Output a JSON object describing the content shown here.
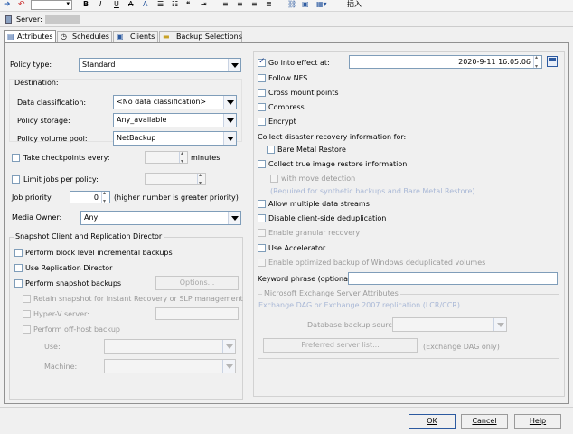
{
  "server": {
    "label": "Server:"
  },
  "tabs": [
    {
      "label": "Attributes"
    },
    {
      "label": "Schedules"
    },
    {
      "label": "Clients"
    },
    {
      "label": "Backup Selections"
    }
  ],
  "toolbar": {
    "insert_label": "插入"
  },
  "left": {
    "policy_type": {
      "label": "Policy type:",
      "value": "Standard"
    },
    "destination": {
      "title": "Destination:",
      "data_classification": {
        "label": "Data classification:",
        "value": "<No data classification>"
      },
      "policy_storage": {
        "label": "Policy storage:",
        "value": "Any_available"
      },
      "policy_volume_pool": {
        "label": "Policy volume pool:",
        "value": "NetBackup"
      }
    },
    "checkpoints": {
      "label": "Take checkpoints every:",
      "unit": "minutes"
    },
    "limit_jobs": {
      "label": "Limit jobs per policy:"
    },
    "job_priority": {
      "label": "Job priority:",
      "value": "0",
      "hint": "(higher number is greater priority)"
    },
    "media_owner": {
      "label": "Media Owner:",
      "value": "Any"
    },
    "snapshot": {
      "title": "Snapshot Client and Replication Director",
      "block_level": "Perform block level incremental backups",
      "replication_director": "Use Replication Director",
      "snapshot_backups": "Perform snapshot backups",
      "options_button": "Options...",
      "retain": "Retain snapshot for Instant Recovery or SLP management",
      "hyperv": "Hyper-V server:",
      "offhost": "Perform off-host backup",
      "use_label": "Use:",
      "machine_label": "Machine:"
    }
  },
  "right": {
    "go_into_effect": {
      "label": "Go into effect at:",
      "value": "2020-9-11 16:05:06",
      "checked": true
    },
    "follow_nfs": "Follow NFS",
    "cross_mount": "Cross mount points",
    "compress": "Compress",
    "encrypt": "Encrypt",
    "collect_dr": "Collect disaster recovery information for:",
    "bare_metal": "Bare Metal Restore",
    "collect_true": "Collect true image restore information",
    "move_detection": "with move detection",
    "required_note": "(Required for synthetic backups and Bare Metal Restore)",
    "multiple_streams": "Allow multiple data streams",
    "disable_dedup": "Disable client-side deduplication",
    "granular": "Enable granular recovery",
    "accelerator": "Use Accelerator",
    "optimized_windows": "Enable optimized backup of Windows deduplicated volumes",
    "keyword": {
      "label": "Keyword phrase (optional):",
      "value": ""
    },
    "exchange": {
      "title": "Microsoft Exchange Server Attributes",
      "dag_note": "Exchange DAG or Exchange 2007 replication (LCR/CCR)",
      "db_source_label": "Database backup source:",
      "preferred_button": "Preferred server list...",
      "dag_only": "(Exchange DAG only)"
    }
  },
  "footer": {
    "ok": "OK",
    "cancel": "Cancel",
    "help": "Help"
  },
  "colors": {
    "accent": "#1b3a8a",
    "panel": "#f0f0f0",
    "border": "#d2d2d2"
  }
}
